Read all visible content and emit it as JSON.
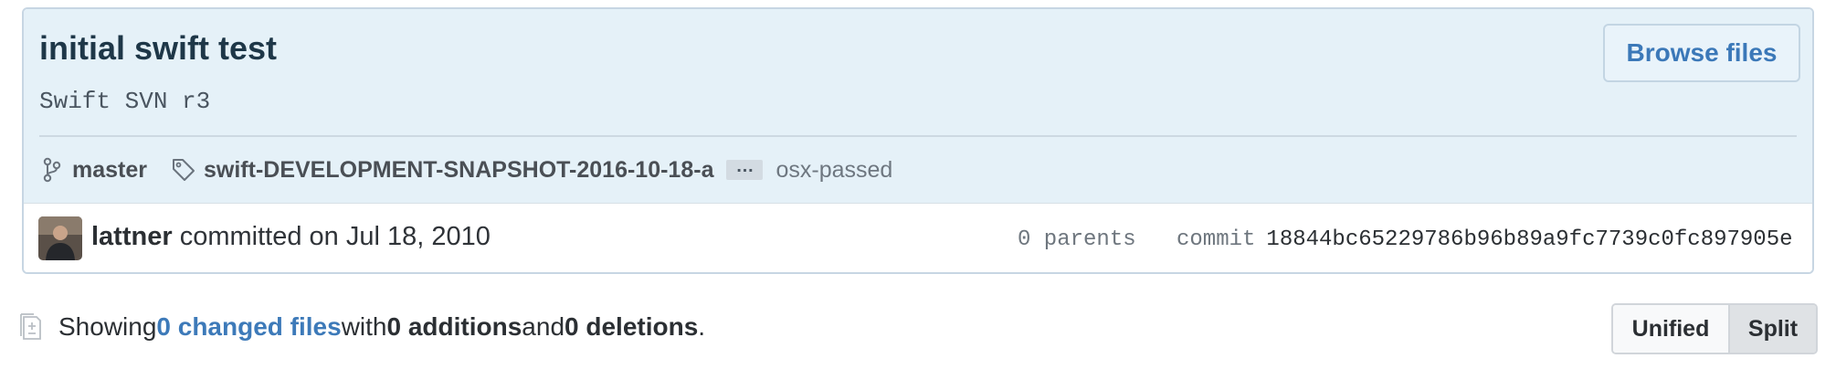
{
  "commit": {
    "title": "initial swift test",
    "description": "Swift SVN r3",
    "browse_label": "Browse files",
    "branch": "master",
    "tag": "swift-DEVELOPMENT-SNAPSHOT-2016-10-18-a",
    "more_refs_label": "…",
    "extra_ref": "osx-passed",
    "author": "lattner",
    "committed_text": "committed on Jul 18, 2010",
    "parents_text": "0 parents",
    "sha_label": "commit",
    "sha": "18844bc65229786b96b89a9fc7739c0fc897905e"
  },
  "toc": {
    "showing": "Showing ",
    "changed_files": "0 changed files",
    "with": " with ",
    "additions": "0 additions",
    "and": " and ",
    "deletions": "0 deletions",
    "period": "."
  },
  "diff_view": {
    "options": [
      "Unified",
      "Split"
    ],
    "selected": "Split"
  },
  "icons": {
    "branch": "git-branch-icon",
    "tag": "tag-icon",
    "file_diff": "file-diff-icon"
  },
  "colors": {
    "header_bg": "#e5f1f8",
    "link": "#3d7ab9",
    "title": "#1e3748"
  }
}
